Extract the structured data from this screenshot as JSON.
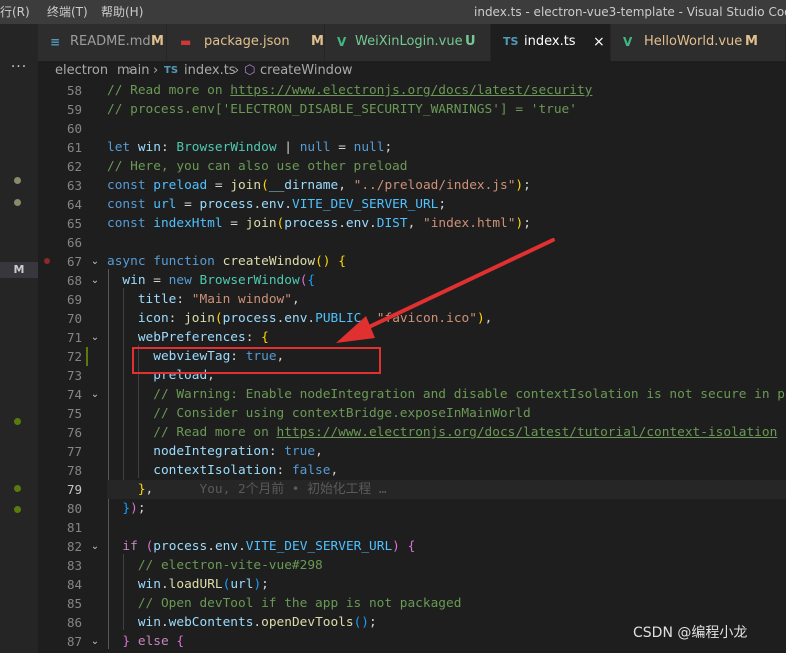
{
  "menu": {
    "run": "行(R)",
    "terminal": "终端(T)",
    "help": "帮助(H)"
  },
  "window_title": "index.ts - electron-vue3-template - Visual Studio Code",
  "activity": {
    "more": "···",
    "scm_badge": "M"
  },
  "tabs": [
    {
      "icon": "≡",
      "name": "README.md",
      "status": "M",
      "icon_color": "#519aba"
    },
    {
      "icon": "▬",
      "name": "package.json",
      "status": "M",
      "icon_color": "#cb3837"
    },
    {
      "icon": "V",
      "name": "WeiXinLogin.vue",
      "status": "U",
      "icon_color": "#41b883"
    },
    {
      "icon": "TS",
      "name": "index.ts",
      "close": "×",
      "icon_color": "#519aba"
    },
    {
      "icon": "V",
      "name": "HelloWorld.vue",
      "status": "M",
      "icon_color": "#41b883"
    }
  ],
  "breadcrumb": {
    "folder1": "electron",
    "sep1": "›",
    "folder2": "main",
    "sep2": "›",
    "ts_icon": "TS",
    "file": "index.ts",
    "sep3": "›",
    "symbol_icon": "⬡",
    "symbol": "createWindow"
  },
  "line_numbers": [
    "58",
    "59",
    "60",
    "61",
    "62",
    "63",
    "64",
    "65",
    "66",
    "67",
    "68",
    "69",
    "70",
    "71",
    "72",
    "73",
    "74",
    "75",
    "76",
    "77",
    "78",
    "79",
    "80",
    "81",
    "82",
    "83",
    "84",
    "85",
    "86",
    "87"
  ],
  "code": {
    "l58_comment": "// Read more on ",
    "l58_url": "https://www.electronjs.org/docs/latest/security",
    "l59": "// process.env['ELECTRON_DISABLE_SECURITY_WARNINGS'] = 'true'",
    "l61_let": "let",
    "l61_win": "win",
    "l61_type": "BrowserWindow",
    "l61_pipe": " | ",
    "l61_null1": "null",
    "l61_null2": "null",
    "l62": "// Here, you can also use other preload",
    "l63_const": "const",
    "l63_preload": "preload",
    "l63_join": "join",
    "l63_dirname": "__dirname",
    "l63_str": "\"../preload/index.js\"",
    "l64_const": "const",
    "l64_url": "url",
    "l64_process": "process",
    "l64_env": "env",
    "l64_var": "VITE_DEV_SERVER_URL",
    "l65_const": "const",
    "l65_html": "indexHtml",
    "l65_join": "join",
    "l65_process": "process",
    "l65_env": "env",
    "l65_dist": "DIST",
    "l65_str": "\"index.html\"",
    "l67_async": "async",
    "l67_function": "function",
    "l67_name": "createWindow",
    "l68_win": "win",
    "l68_new": "new",
    "l68_type": "BrowserWindow",
    "l69_title": "title",
    "l69_str": "\"Main window\"",
    "l70_icon": "icon",
    "l70_join": "join",
    "l70_process": "process",
    "l70_env": "env",
    "l70_public": "PUBLIC",
    "l70_str": "\"favicon.ico\"",
    "l71_key": "webPreferences",
    "l72_key": "webviewTag",
    "l72_val": "true",
    "l73_key": "preload",
    "l74": "// Warning: Enable nodeIntegration and disable contextIsolation is not secure in pr",
    "l75": "// Consider using contextBridge.exposeInMainWorld",
    "l76_comment": "// Read more on ",
    "l76_url": "https://www.electronjs.org/docs/latest/tutorial/context-isolation",
    "l77_key": "nodeIntegration",
    "l77_val": "true",
    "l78_key": "contextIsolation",
    "l78_val": "false",
    "l79_blame": "You, 2个月前 • 初始化工程 …",
    "l82_if": "if",
    "l82_process": "process",
    "l82_env": "env",
    "l82_var": "VITE_DEV_SERVER_URL",
    "l83": "// electron-vite-vue#298",
    "l84_win": "win",
    "l84_fn": "loadURL",
    "l84_arg": "url",
    "l85": "// Open devTool if the app is not packaged",
    "l86_win": "win",
    "l86_wc": "webContents",
    "l86_fn": "openDevTools",
    "l87_else": "else"
  },
  "watermark": "CSDN @编程小龙",
  "colors": {
    "annotation_red": "#e03030",
    "accent_modified": "#e2c08d",
    "untracked": "#73c991",
    "dot_green": "#587c0c"
  }
}
